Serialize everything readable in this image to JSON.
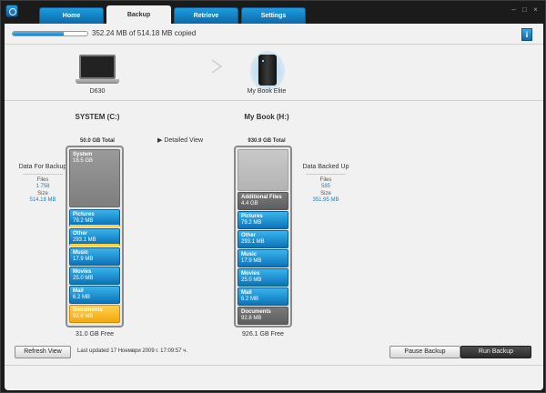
{
  "tabs": [
    {
      "label": "Home",
      "active": false
    },
    {
      "label": "Backup",
      "active": true
    },
    {
      "label": "Retrieve",
      "active": false
    },
    {
      "label": "Settings",
      "active": false
    }
  ],
  "window_controls": {
    "minimize": "–",
    "maximize": "□",
    "close": "×"
  },
  "progress": {
    "text": "352.24 MB of 514.18 MB copied",
    "fraction": 0.685
  },
  "info_button": {
    "label": "i"
  },
  "source_device": {
    "name": "D630"
  },
  "target_device": {
    "name": "My Book Elite"
  },
  "source": {
    "title": "SYSTEM (C:)",
    "total": "50.0 GB Total",
    "free": "31.0 GB Free",
    "segments": [
      {
        "name": "System",
        "value": "18.5 GB"
      },
      {
        "name": "Pictures",
        "value": "79.2 MB"
      },
      {
        "name": "Other",
        "value": "293.1 MB"
      },
      {
        "name": "Music",
        "value": "17.9 MB"
      },
      {
        "name": "Movies",
        "value": "25.0 MB"
      },
      {
        "name": "Mail",
        "value": "6.2 MB"
      },
      {
        "name": "Documents",
        "value": "92.8 MB"
      }
    ]
  },
  "target": {
    "title": "My Book (H:)",
    "total": "930.9 GB Total",
    "free": "926.1 GB Free",
    "segments": [
      {
        "name": "Additional Files",
        "value": "4.4 GB"
      },
      {
        "name": "Pictures",
        "value": "79.2 MB"
      },
      {
        "name": "Other",
        "value": "293.1 MB"
      },
      {
        "name": "Music",
        "value": "17.9 MB"
      },
      {
        "name": "Movies",
        "value": "25.0 MB"
      },
      {
        "name": "Mail",
        "value": "6.2 MB"
      },
      {
        "name": "Documents",
        "value": "92.8 MB"
      }
    ]
  },
  "detailed_view": {
    "label": "Detailed View"
  },
  "left_stats": {
    "title": "Data For Backup",
    "files_label": "Files",
    "files_value": "1 758",
    "size_label": "Size",
    "size_value": "514.18 MB"
  },
  "right_stats": {
    "title": "Data Backed Up",
    "files_label": "Files",
    "files_value": "585",
    "size_label": "Size",
    "size_value": "351.95 MB"
  },
  "refresh_button": {
    "label": "Refresh View"
  },
  "last_updated": "Last updated 17 Ноември 2009 г. 17:09:57 ч.",
  "pause_button": {
    "label": "Pause Backup"
  },
  "run_button": {
    "label": "Run Backup"
  },
  "colors": {
    "accent": "#1a8fd6",
    "documents": "#f4b41d",
    "window": "#1b1b1b"
  }
}
